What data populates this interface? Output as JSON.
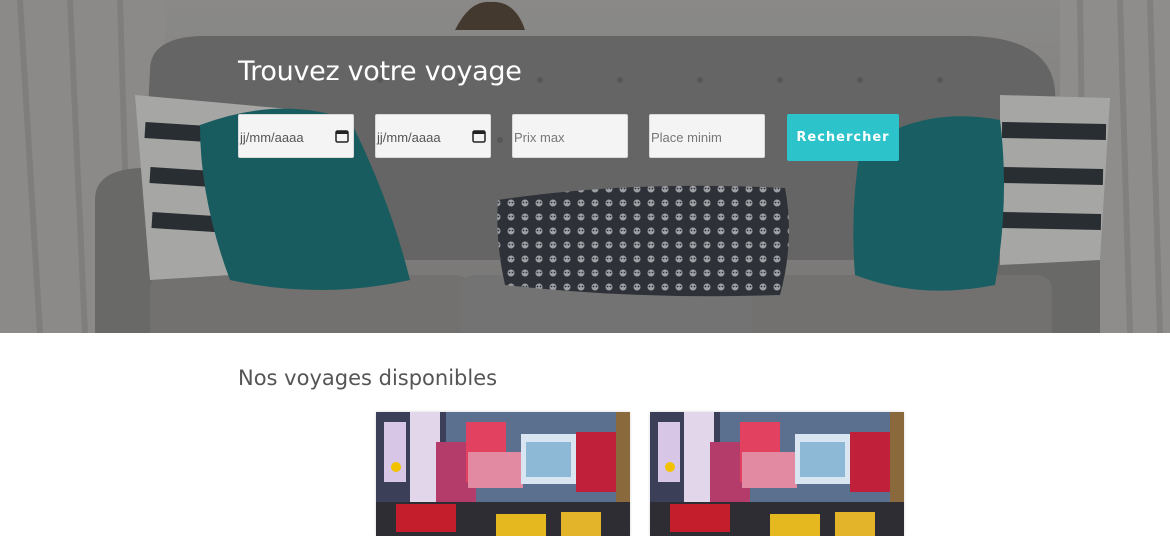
{
  "hero": {
    "title": "Trouvez votre voyage",
    "search": {
      "date_start": {
        "value": "jj/mm/aaaa",
        "icon": "calendar-icon"
      },
      "date_end": {
        "value": "jj/mm/aaaa",
        "icon": "calendar-icon"
      },
      "max_price": {
        "placeholder": "Prix max"
      },
      "min_seats": {
        "placeholder": "Place minim"
      },
      "submit_label": "Rechercher"
    }
  },
  "trips": {
    "title": "Nos voyages disponibles",
    "cards": [
      {
        "image": "times-square-photo"
      },
      {
        "image": "times-square-photo"
      }
    ]
  },
  "colors": {
    "accent": "#2cc3cb",
    "hero_text": "#ffffff",
    "section_title": "#555555"
  }
}
